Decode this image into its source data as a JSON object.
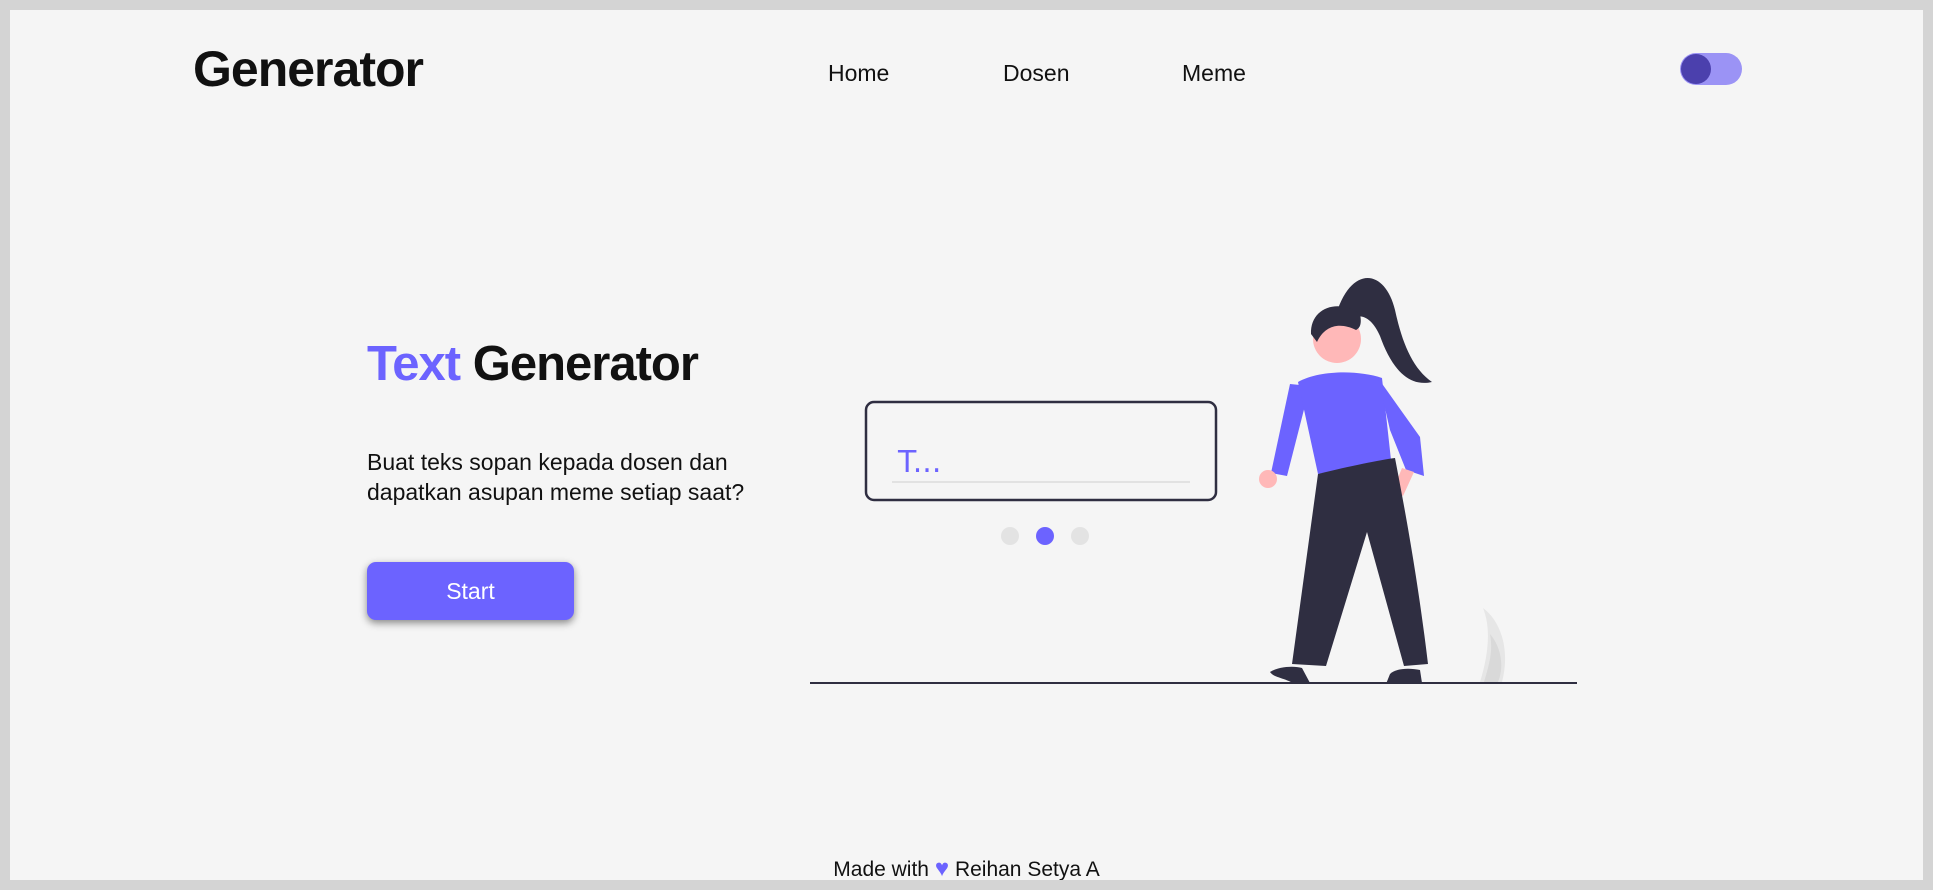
{
  "header": {
    "logo": "Generator",
    "nav": [
      "Home",
      "Dosen",
      "Meme"
    ],
    "theme_toggle": {
      "state": "on"
    }
  },
  "hero": {
    "title_accent": "Text",
    "title_rest": "Generator",
    "description": "Buat teks sopan kepada dosen dan dapatkan asupan meme setiap saat?",
    "start_label": "Start"
  },
  "illustration": {
    "input_text": "T...",
    "carousel_dots": 3,
    "active_dot": 2
  },
  "footer": {
    "prefix": "Made with",
    "heart": "♥",
    "author": "Reihan Setya A"
  },
  "colors": {
    "accent": "#6c63ff",
    "dark": "#2f2e41",
    "skin": "#ffb8b8",
    "background": "#f5f5f5"
  }
}
